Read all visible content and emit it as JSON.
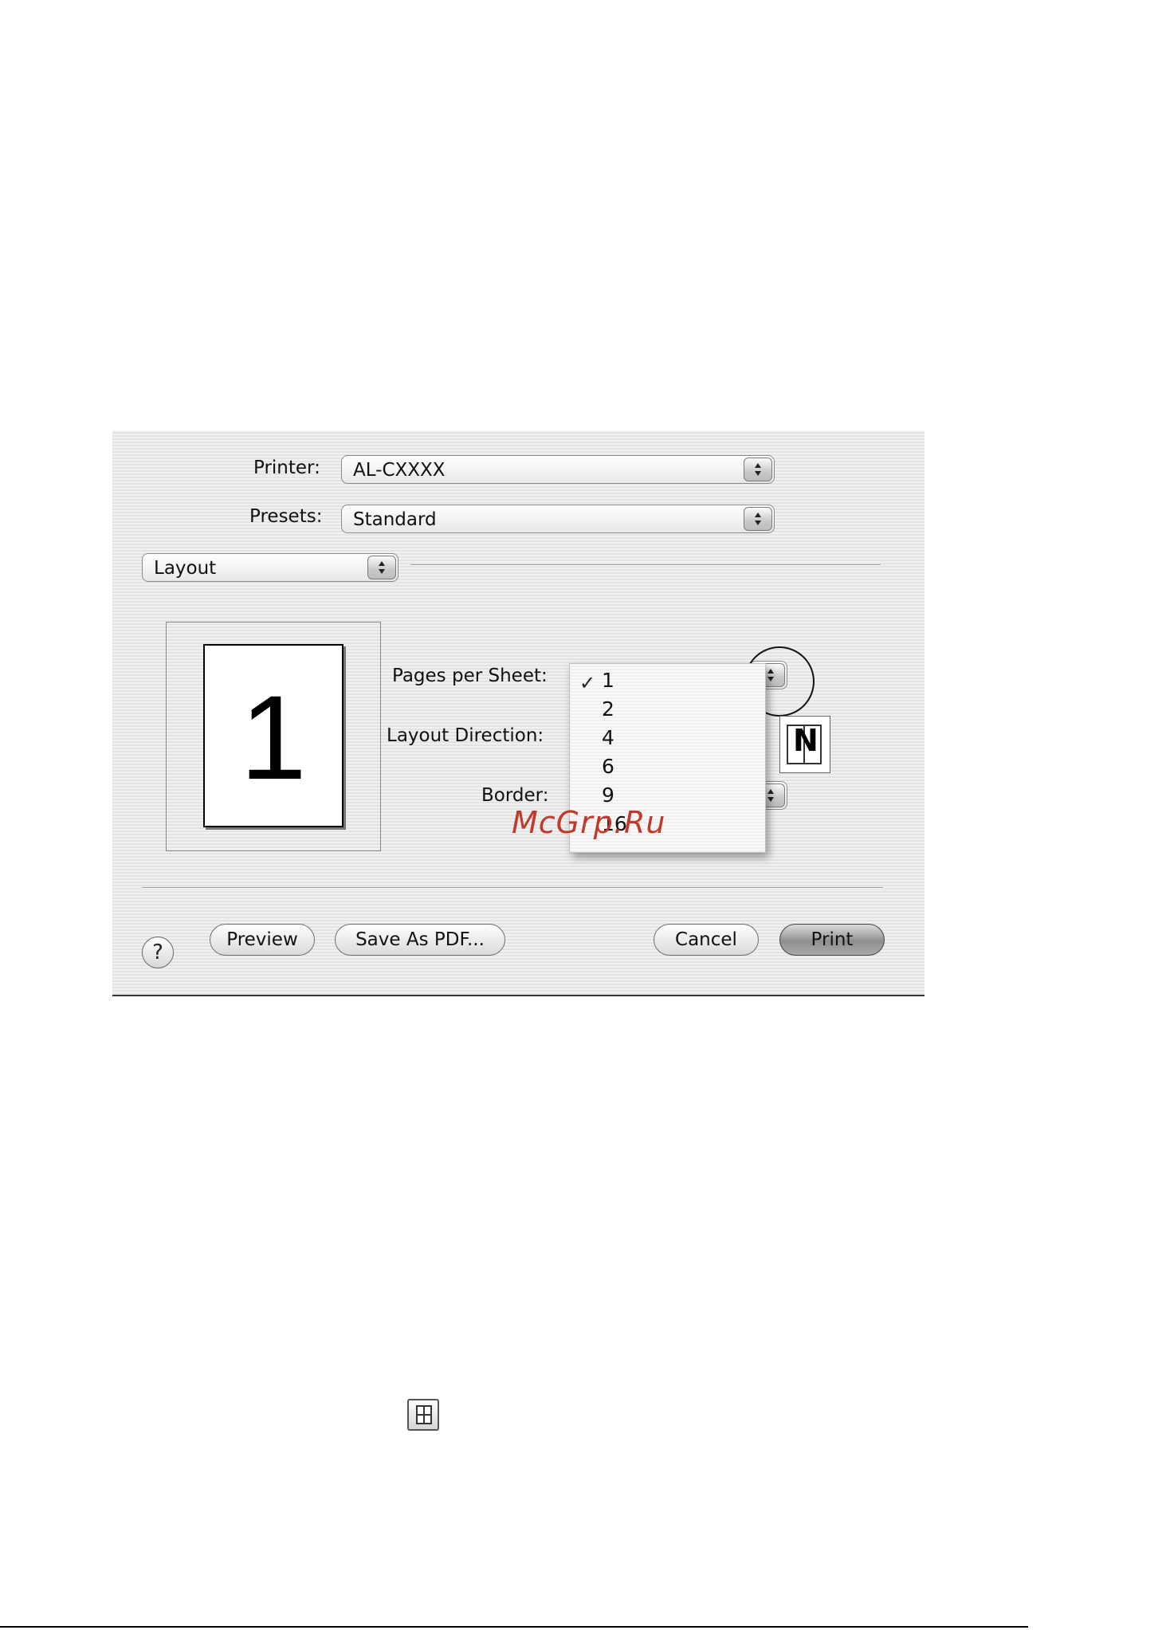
{
  "dialog": {
    "printer_label": "Printer:",
    "printer_value": "AL-CXXXX",
    "presets_label": "Presets:",
    "presets_value": "Standard",
    "pane_value": "Layout",
    "preview_page_number": "1",
    "pages_per_sheet_label": "Pages per Sheet:",
    "layout_direction_label": "Layout Direction:",
    "border_label": "Border:",
    "pages_per_sheet_menu": {
      "options": [
        "1",
        "2",
        "4",
        "6",
        "9",
        "16"
      ],
      "selected": "1",
      "check_glyph": "✓"
    },
    "layout_direction_glyph": "N",
    "buttons": {
      "help": "?",
      "preview": "Preview",
      "save_pdf": "Save As PDF...",
      "cancel": "Cancel",
      "print": "Print"
    }
  },
  "watermark": "McGrp.Ru",
  "icons": {
    "stepper": "up-down-arrows-icon",
    "help": "help-icon",
    "layout_direction": "layout-direction-n-icon",
    "layout_small": "layout-icon"
  }
}
